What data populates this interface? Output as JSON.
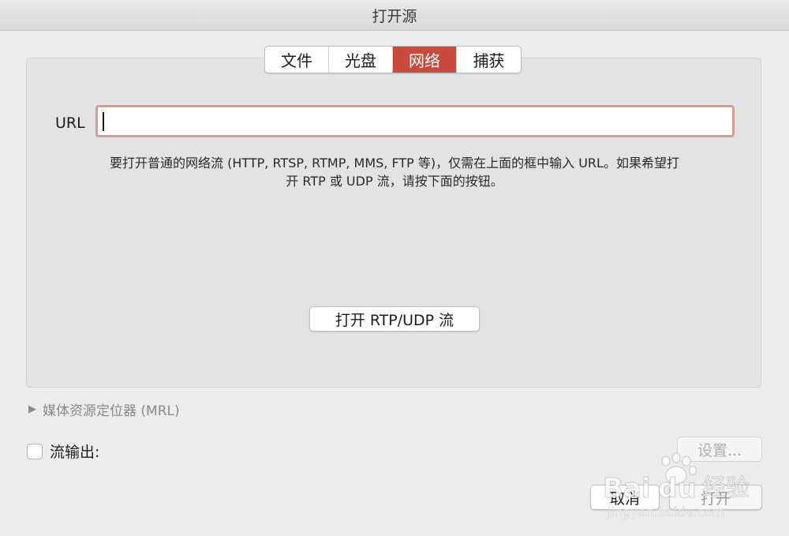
{
  "window": {
    "title": "打开源"
  },
  "tabs": [
    {
      "label": "文件",
      "active": false
    },
    {
      "label": "光盘",
      "active": false
    },
    {
      "label": "网络",
      "active": true
    },
    {
      "label": "捕获",
      "active": false
    }
  ],
  "network": {
    "url_label": "URL",
    "url_value": "",
    "help_line1": "要打开普通的网络流 (HTTP, RTSP, RTMP, MMS, FTP 等)，仅需在上面的框中输入 URL。如果希望打",
    "help_line2": "开 RTP 或 UDP 流，请按下面的按钮。",
    "rtp_button_label": "打开 RTP/UDP 流"
  },
  "mrl": {
    "label": "媒体资源定位器 (MRL)"
  },
  "stream_output": {
    "label": "流输出:",
    "checked": false,
    "settings_button_label": "设置..."
  },
  "footer": {
    "cancel_label": "取消",
    "open_label": "打开"
  },
  "watermark": {
    "brand": "Bai",
    "brand2": "du",
    "cn": "经验",
    "url": "jingyan.baidu.com"
  },
  "colors": {
    "accent": "#c8493d",
    "focus_ring": "#d99a95"
  }
}
